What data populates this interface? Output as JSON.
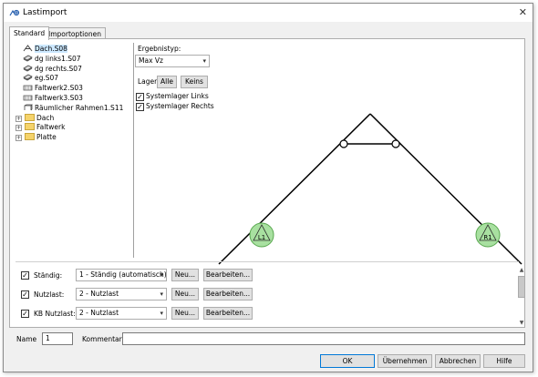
{
  "window": {
    "title": "Lastimport",
    "close": "✕"
  },
  "tabs": [
    "Standard",
    "Importoptionen"
  ],
  "tree": [
    {
      "label": "Dach.S08",
      "icon": "frame-icon",
      "type": "item",
      "selected": true
    },
    {
      "label": "dg links1.S07",
      "icon": "slab-icon",
      "type": "item"
    },
    {
      "label": "dg rechts.S07",
      "icon": "slab-icon",
      "type": "item"
    },
    {
      "label": "eg.S07",
      "icon": "slab-icon",
      "type": "item"
    },
    {
      "label": "Faltwerk2.S03",
      "icon": "folded-plate-icon",
      "type": "item"
    },
    {
      "label": "Faltwerk3.S03",
      "icon": "folded-plate-icon",
      "type": "item"
    },
    {
      "label": "Räumlicher Rahmen1.S11",
      "icon": "spatial-frame-icon",
      "type": "item"
    },
    {
      "label": "Dach",
      "icon": "folder-icon",
      "type": "folder"
    },
    {
      "label": "Faltwerk",
      "icon": "folder-icon",
      "type": "folder"
    },
    {
      "label": "Platte",
      "icon": "folder-icon",
      "type": "folder"
    }
  ],
  "ergebnistyp": {
    "label": "Ergebnistyp:",
    "value": "Max Vz"
  },
  "lager": {
    "label": "Lager:",
    "alle": "Alle",
    "keins": "Keins"
  },
  "checks": {
    "links": "Systemlager Links",
    "rechts": "Systemlager Rechts"
  },
  "drawing": {
    "support_left": "L1",
    "support_right": "R1"
  },
  "loads": [
    {
      "name": "Ständig:",
      "case": "1 - Ständig (automatisch)",
      "neu": "Neu...",
      "edit": "Bearbeiten...",
      "checked": true
    },
    {
      "name": "Nutzlast:",
      "case": "2 - Nutzlast",
      "neu": "Neu...",
      "edit": "Bearbeiten...",
      "checked": true
    },
    {
      "name": "KB Nutzlast:",
      "case": "2 - Nutzlast",
      "neu": "Neu...",
      "edit": "Bearbeiten...",
      "checked": true
    }
  ],
  "bottom": {
    "name_label": "Name",
    "name_value": "1",
    "kommentar_label": "Kommentar",
    "kommentar_value": ""
  },
  "buttons": {
    "ok": "OK",
    "uebernehmen": "Übernehmen",
    "abbrechen": "Abbrechen",
    "hilfe": "Hilfe"
  },
  "colors": {
    "support_fill": "#a8e0a0",
    "support_stroke": "#5aa850",
    "accent": "#0078d7"
  }
}
